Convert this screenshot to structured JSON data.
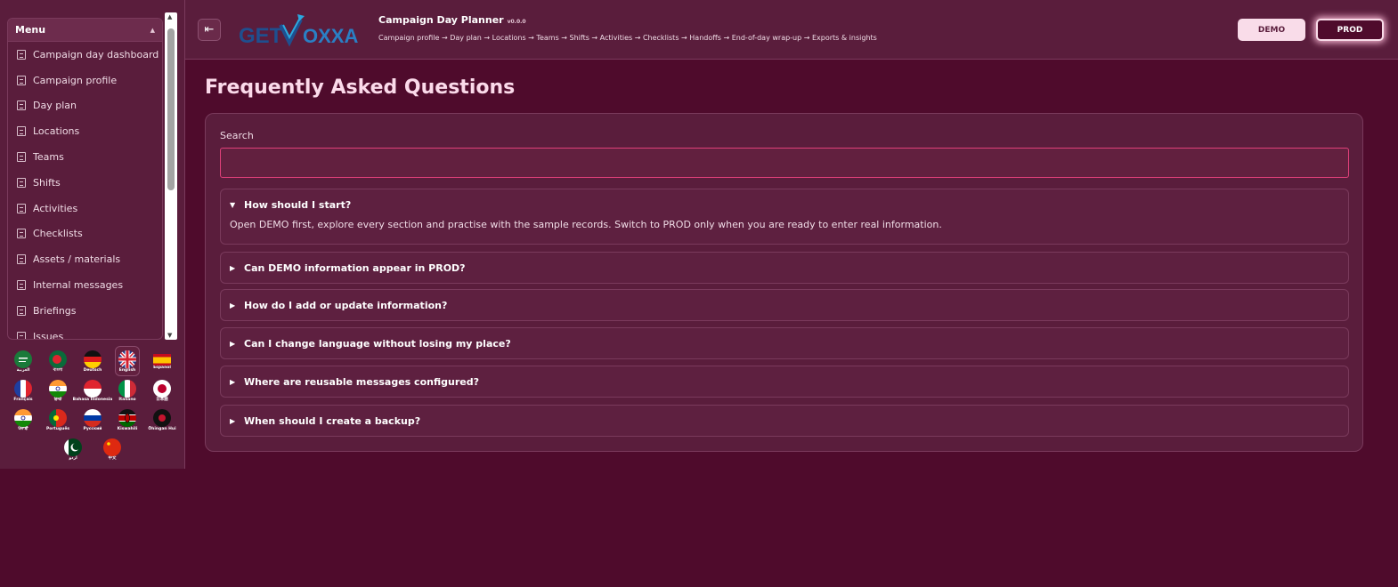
{
  "sidebar": {
    "menu_title": "Menu",
    "items": [
      {
        "label": "Campaign day dashboard",
        "icon": "document-icon"
      },
      {
        "label": "Campaign profile",
        "icon": "document-icon"
      },
      {
        "label": "Day plan",
        "icon": "document-icon"
      },
      {
        "label": "Locations",
        "icon": "document-icon"
      },
      {
        "label": "Teams",
        "icon": "document-icon"
      },
      {
        "label": "Shifts",
        "icon": "document-icon"
      },
      {
        "label": "Activities",
        "icon": "document-icon"
      },
      {
        "label": "Checklists",
        "icon": "document-icon"
      },
      {
        "label": "Assets / materials",
        "icon": "document-icon"
      },
      {
        "label": "Internal messages",
        "icon": "document-icon"
      },
      {
        "label": "Briefings",
        "icon": "document-icon"
      },
      {
        "label": "Issues",
        "icon": "document-icon"
      }
    ],
    "languages": [
      {
        "label": "العربية",
        "flag": "saudi-arabia"
      },
      {
        "label": "বাংলা",
        "flag": "bangladesh"
      },
      {
        "label": "Deutsch",
        "flag": "germany"
      },
      {
        "label": "English",
        "flag": "united-kingdom",
        "active": true
      },
      {
        "label": "Español",
        "flag": "spain"
      },
      {
        "label": "Français",
        "flag": "france"
      },
      {
        "label": "हिन्दी",
        "flag": "india"
      },
      {
        "label": "Bahasa Indonesia",
        "flag": "indonesia"
      },
      {
        "label": "Italiano",
        "flag": "italy"
      },
      {
        "label": "日本語",
        "flag": "japan"
      },
      {
        "label": "ਪੰਜਾਬੀ",
        "flag": "india"
      },
      {
        "label": "Português",
        "flag": "portugal"
      },
      {
        "label": "Pусский",
        "flag": "russia"
      },
      {
        "label": "Kiswahili",
        "flag": "kenya"
      },
      {
        "label": "Ōhingan Hui",
        "flag": "black-circle"
      },
      {
        "label": "اردو",
        "flag": "pakistan"
      },
      {
        "label": "中文",
        "flag": "china"
      }
    ]
  },
  "header": {
    "logo_text": "GETVOXXA",
    "title": "Campaign Day Planner",
    "version": "v0.0.0",
    "breadcrumb": "Campaign profile → Day plan → Locations → Teams → Shifts → Activities → Checklists → Handoffs → End-of-day wrap-up → Exports & insights",
    "demo_label": "DEMO",
    "prod_label": "PROD",
    "active_env": "PROD"
  },
  "main": {
    "page_title": "Frequently Asked Questions",
    "search_label": "Search",
    "search_value": "",
    "faqs": [
      {
        "question": "How should I start?",
        "expanded": true,
        "answer": "Open DEMO first, explore every section and practise with the sample records. Switch to PROD only when you are ready to enter real information."
      },
      {
        "question": "Can DEMO information appear in PROD?",
        "expanded": false
      },
      {
        "question": "How do I add or update information?",
        "expanded": false
      },
      {
        "question": "Can I change language without losing my place?",
        "expanded": false
      },
      {
        "question": "Where are reusable messages configured?",
        "expanded": false
      },
      {
        "question": "When should I create a backup?",
        "expanded": false
      }
    ]
  },
  "colors": {
    "background": "#4f0b2c",
    "panel": "#5a1d3c",
    "accent": "#e0407a",
    "button_light": "#f9dce9"
  }
}
